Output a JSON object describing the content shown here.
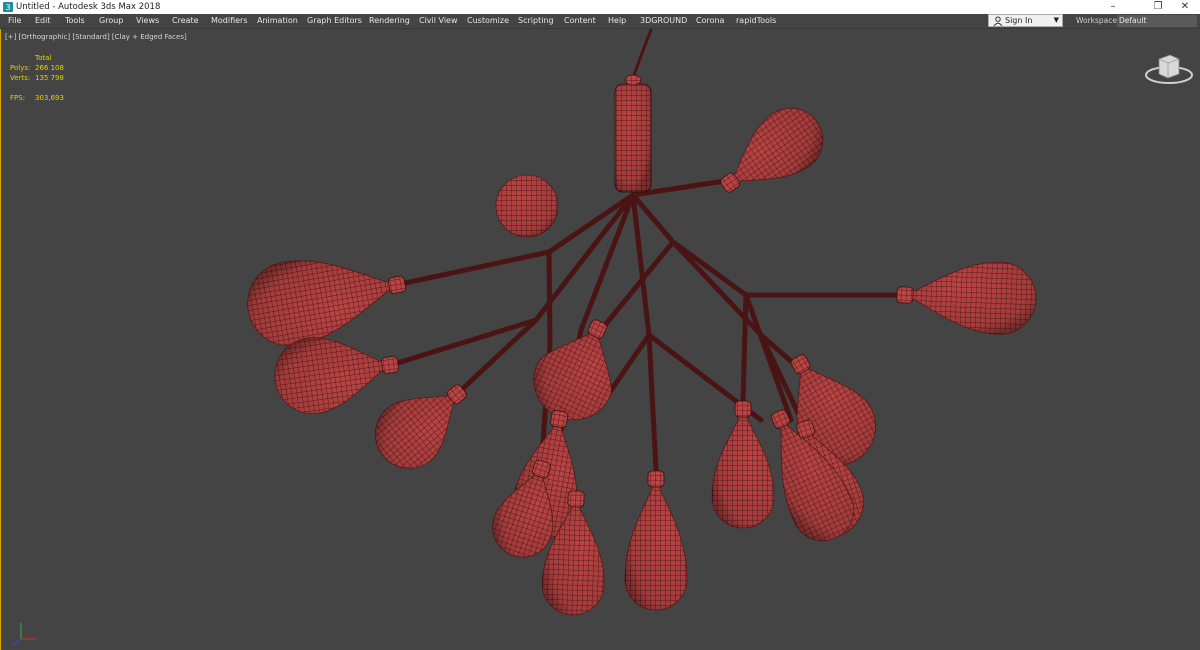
{
  "window": {
    "title": "Untitled - Autodesk 3ds Max 2018",
    "minimize": "–",
    "restore": "❐",
    "close": "✕"
  },
  "menubar": [
    {
      "label": "File"
    },
    {
      "label": "Edit"
    },
    {
      "label": "Tools"
    },
    {
      "label": "Group"
    },
    {
      "label": "Views"
    },
    {
      "label": "Create"
    },
    {
      "label": "Modifiers"
    },
    {
      "label": "Animation"
    },
    {
      "label": "Graph Editors"
    },
    {
      "label": "Rendering"
    },
    {
      "label": "Civil View"
    },
    {
      "label": "Customize"
    },
    {
      "label": "Scripting"
    },
    {
      "label": "Content"
    },
    {
      "label": "Help"
    },
    {
      "label": "3DGROUND"
    },
    {
      "label": "Corona"
    },
    {
      "label": "rapidTools"
    }
  ],
  "account": {
    "signin_label": "Sign In",
    "caret": "▼"
  },
  "workspaces": {
    "label": "Workspaces:",
    "value": "Default"
  },
  "viewport": {
    "label": "[+] [Orthographic] [Standard] [Clay + Edged Faces]",
    "stats": {
      "total_label": "Total",
      "polys_label": "Polys:",
      "polys_value": "266 108",
      "verts_label": "Verts:",
      "verts_value": "135 798",
      "fps_label": "FPS:",
      "fps_value": "303,693"
    }
  },
  "colors": {
    "clay": "#b94444",
    "wire": "#3a0f0f",
    "stem": "#4a1414",
    "viewport_bg": "#444444",
    "border_accent": "#d8a600",
    "stats_text": "#e6d200"
  }
}
